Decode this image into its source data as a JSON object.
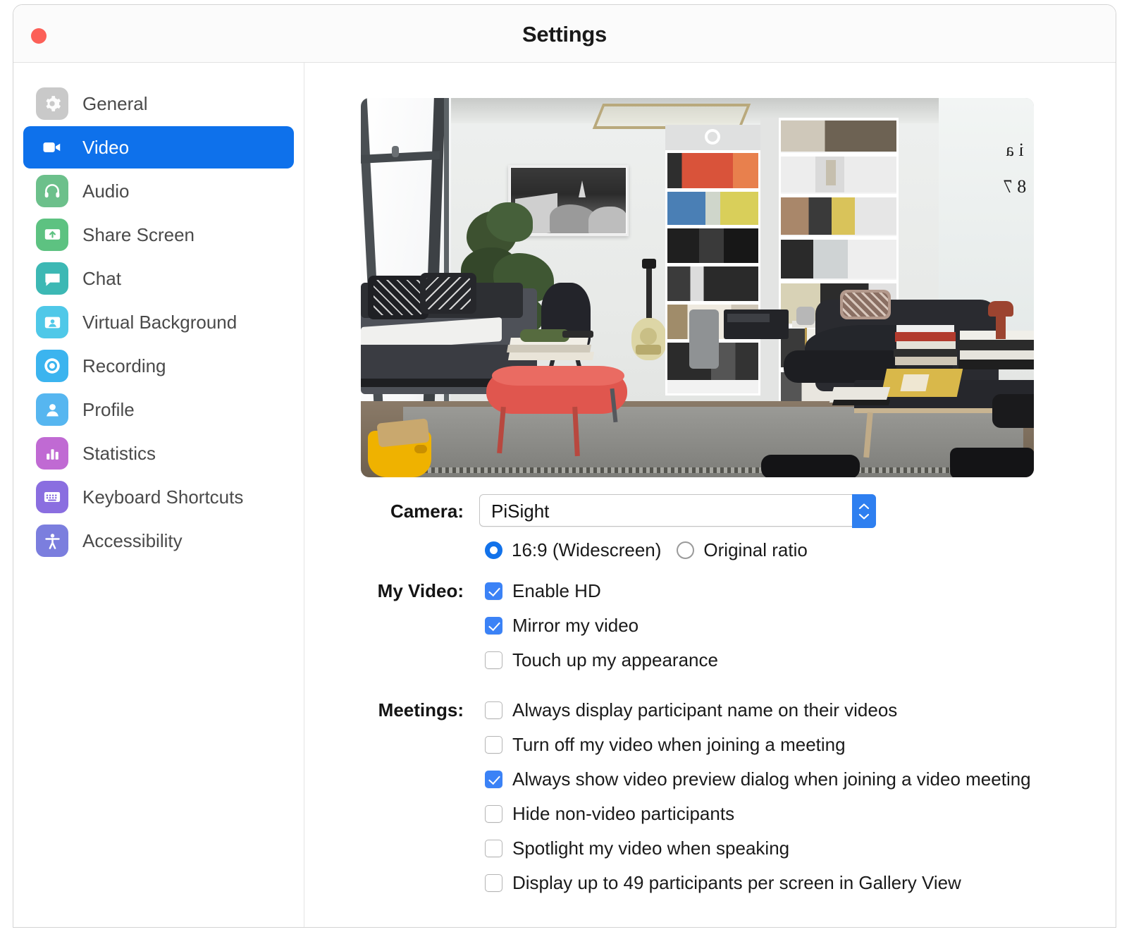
{
  "window": {
    "title": "Settings",
    "close_button": "close",
    "accent_color": "#0e71eb",
    "close_color": "#fc6058"
  },
  "sidebar": {
    "items": [
      {
        "label": "General",
        "icon": "gear-icon",
        "color": "#c9c9c9",
        "active": false
      },
      {
        "label": "Video",
        "icon": "video-camera-icon",
        "color": "#0e71eb",
        "active": true
      },
      {
        "label": "Audio",
        "icon": "headphones-icon",
        "color": "#6cc08b",
        "active": false
      },
      {
        "label": "Share Screen",
        "icon": "share-screen-icon",
        "color": "#5dc281",
        "active": false
      },
      {
        "label": "Chat",
        "icon": "chat-bubble-icon",
        "color": "#3cb8b4",
        "active": false
      },
      {
        "label": "Virtual Background",
        "icon": "virtual-background-icon",
        "color": "#4fc8e8",
        "active": false
      },
      {
        "label": "Recording",
        "icon": "record-circle-icon",
        "color": "#3bb4ef",
        "active": false
      },
      {
        "label": "Profile",
        "icon": "person-icon",
        "color": "#56b6f0",
        "active": false
      },
      {
        "label": "Statistics",
        "icon": "bar-chart-icon",
        "color": "#c06ad3",
        "active": false
      },
      {
        "label": "Keyboard Shortcuts",
        "icon": "keyboard-icon",
        "color": "#8a6ee0",
        "active": false
      },
      {
        "label": "Accessibility",
        "icon": "accessibility-icon",
        "color": "#7b7ede",
        "active": false
      }
    ]
  },
  "main": {
    "video_preview": {
      "alt": "camera-preview-living-room",
      "whiteboard_text": "i\na\n8\n7a"
    },
    "camera": {
      "label": "Camera:",
      "selected": "PiSight",
      "dropdown_icon": "chevron-updown-icon"
    },
    "aspect_ratio": {
      "options": [
        {
          "label": "16:9 (Widescreen)",
          "selected": true
        },
        {
          "label": "Original ratio",
          "selected": false
        }
      ]
    },
    "my_video": {
      "label": "My Video:",
      "options": [
        {
          "label": "Enable HD",
          "checked": true
        },
        {
          "label": "Mirror my video",
          "checked": true
        },
        {
          "label": "Touch up my appearance",
          "checked": false
        }
      ]
    },
    "meetings": {
      "label": "Meetings:",
      "options": [
        {
          "label": "Always display participant name on their videos",
          "checked": false
        },
        {
          "label": "Turn off my video when joining a meeting",
          "checked": false
        },
        {
          "label": "Always show video preview dialog when joining a video meeting",
          "checked": true
        },
        {
          "label": "Hide non-video participants",
          "checked": false
        },
        {
          "label": "Spotlight my video when speaking",
          "checked": false
        },
        {
          "label": "Display up to 49 participants per screen in Gallery View",
          "checked": false
        }
      ]
    }
  }
}
